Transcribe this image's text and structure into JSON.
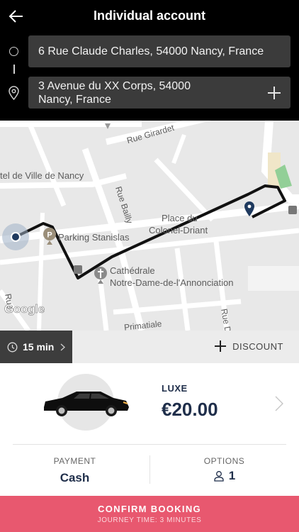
{
  "header": {
    "title": "Individual account"
  },
  "route": {
    "pickup": "6 Rue Claude Charles, 54000 Nancy, France",
    "dropoff_line1": "3 Avenue du XX Corps, 54000",
    "dropoff_line2": "Nancy, France"
  },
  "map": {
    "labels": {
      "rue_girardet": "Rue Girardet",
      "hotel_ville": "tel de Ville de Nancy",
      "rue_bailly": "Rue Bailly",
      "place_du": "Place du",
      "colonel_driant": "Colonel-Driant",
      "parking": "Parking Stanislas",
      "cathedrale_1": "Cathédrale",
      "cathedrale_2": "Notre-Dame-de-l'Annonciation",
      "primatiale": "Primatiale",
      "rue_left": "Rue",
      "rue_d": "Rue D"
    },
    "google": "Google",
    "route_color": "#111111",
    "pin_color": "#1f3a5f"
  },
  "trip": {
    "duration": "15 min",
    "discount_label": "DISCOUNT"
  },
  "vehicle": {
    "class": "LUXE",
    "price": "€20.00"
  },
  "payment": {
    "label": "PAYMENT",
    "value": "Cash"
  },
  "options": {
    "label": "OPTIONS",
    "value": "1"
  },
  "confirm": {
    "label": "CONFIRM BOOKING",
    "journey": "JOURNEY TIME: 3 MINUTES"
  },
  "colors": {
    "header_bg": "#000000",
    "accent": "#e8586f",
    "text_dark": "#1f2e4a"
  }
}
